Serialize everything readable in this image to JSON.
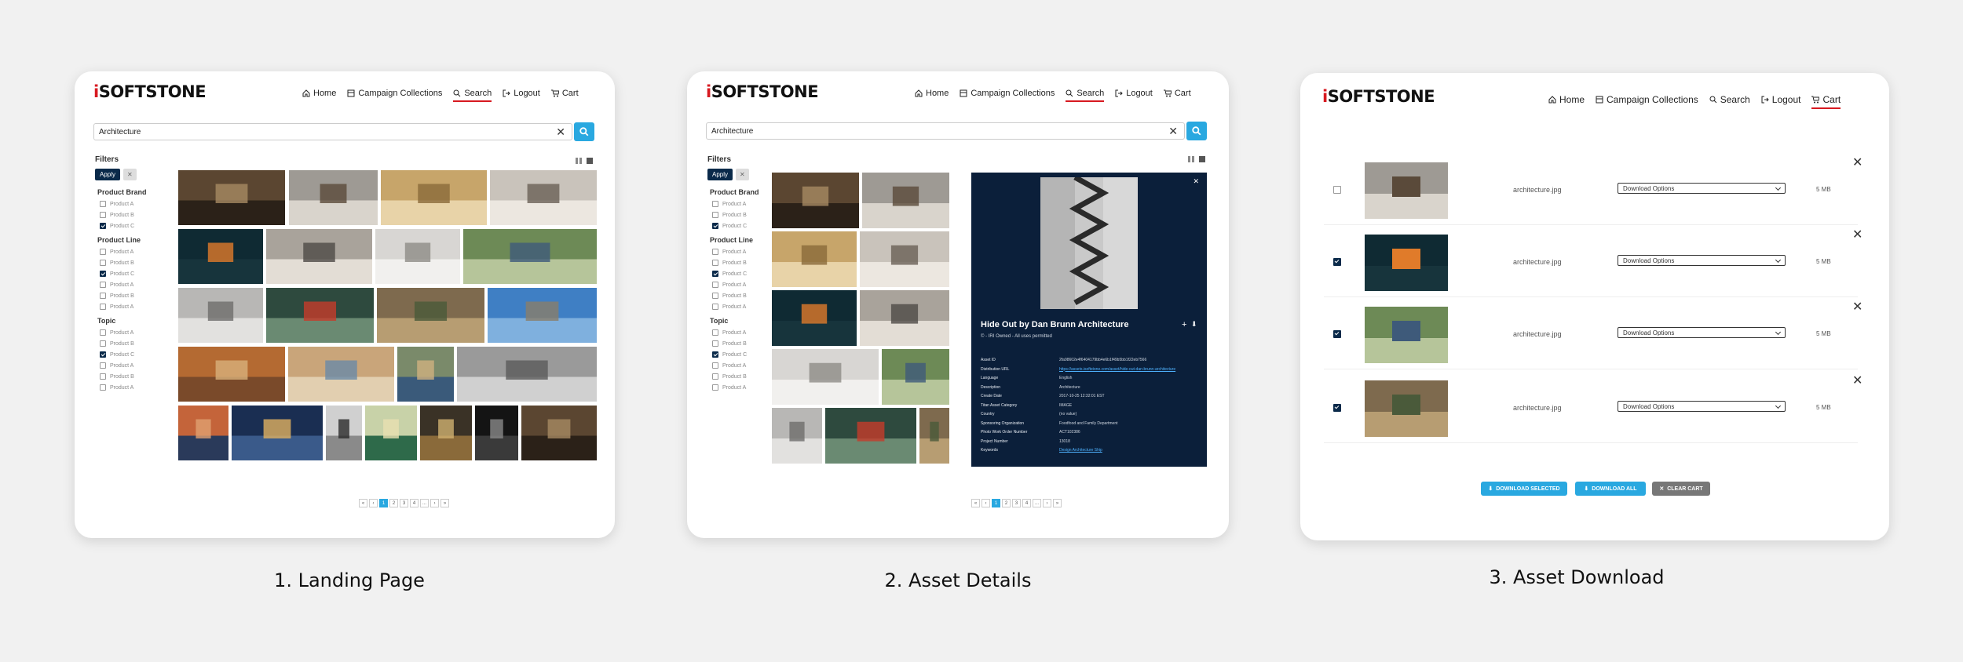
{
  "brand": {
    "logo_text": "SOFTSTONE",
    "logo_i": "i",
    "accent": "#d71920",
    "primary": "#29a8e0",
    "navy": "#0b1f3a"
  },
  "nav": {
    "home": "Home",
    "collections": "Campaign Collections",
    "search": "Search",
    "logout": "Logout",
    "cart": "Cart"
  },
  "captions": {
    "one": "1. Landing Page",
    "two": "2. Asset Details",
    "three": "3. Asset Download"
  },
  "search": {
    "value": "Architecture"
  },
  "filters": {
    "title": "Filters",
    "apply": "Apply",
    "clear": "✕",
    "groups": [
      {
        "name": "Product Brand",
        "options": [
          {
            "label": "Product A",
            "checked": false
          },
          {
            "label": "Product B",
            "checked": false
          },
          {
            "label": "Product C",
            "checked": true
          }
        ]
      },
      {
        "name": "Product Line",
        "options": [
          {
            "label": "Product A",
            "checked": false
          },
          {
            "label": "Product B",
            "checked": false
          },
          {
            "label": "Product C",
            "checked": true
          },
          {
            "label": "Product A",
            "checked": false
          },
          {
            "label": "Product B",
            "checked": false
          },
          {
            "label": "Product A",
            "checked": false
          }
        ]
      },
      {
        "name": "Topic",
        "options": [
          {
            "label": "Product A",
            "checked": false
          },
          {
            "label": "Product B",
            "checked": false
          },
          {
            "label": "Product C",
            "checked": true
          },
          {
            "label": "Product A",
            "checked": false
          },
          {
            "label": "Product B",
            "checked": false
          },
          {
            "label": "Product A",
            "checked": false
          }
        ]
      }
    ]
  },
  "pagination": [
    "«",
    "‹",
    "1",
    "2",
    "3",
    "4",
    "...",
    "›",
    "»"
  ],
  "detail": {
    "title": "Hide Out by Dan Brunn Architecture",
    "subtitle": "© - IRI Owned - All uses permitted",
    "fields": [
      {
        "k": "Asset ID",
        "v": "2fa98602e4f6404179bb4e6b1f49b5bb1f22eb7566"
      },
      {
        "k": "Distribution URL",
        "v": "https://assets.isoftstone.com/asset/hide-out-dan-brunn-architecture",
        "link": true
      },
      {
        "k": "Language",
        "v": "English"
      },
      {
        "k": "Description",
        "v": "Architecture"
      },
      {
        "k": "Create Date",
        "v": "2017-10-25 12:32:01 EST"
      },
      {
        "k": "Titan Asset Category",
        "v": "IMAGE"
      },
      {
        "k": "Country",
        "v": "(no value)"
      },
      {
        "k": "Sponsoring Organization",
        "v": "Foodfood and Family Department"
      },
      {
        "k": "Photo Work Order Number",
        "v": "ACT102386"
      },
      {
        "k": "Project Number",
        "v": "13018"
      },
      {
        "k": "Keywords",
        "v": "Design    Architecture    Ship",
        "link": true
      }
    ]
  },
  "cart": {
    "items": [
      {
        "checked": false,
        "file": "architecture.jpg",
        "option": "Download Options",
        "size": "5 MB"
      },
      {
        "checked": true,
        "file": "architecture.jpg",
        "option": "Download Options",
        "size": "5 MB"
      },
      {
        "checked": true,
        "file": "architecture.jpg",
        "option": "Download Options",
        "size": "5 MB"
      },
      {
        "checked": true,
        "file": "architecture.jpg",
        "option": "Download Options",
        "size": "5 MB"
      }
    ],
    "download_selected": "DOWNLOAD SELECTED",
    "download_all": "DOWNLOAD ALL",
    "clear_cart": "CLEAR CART"
  }
}
